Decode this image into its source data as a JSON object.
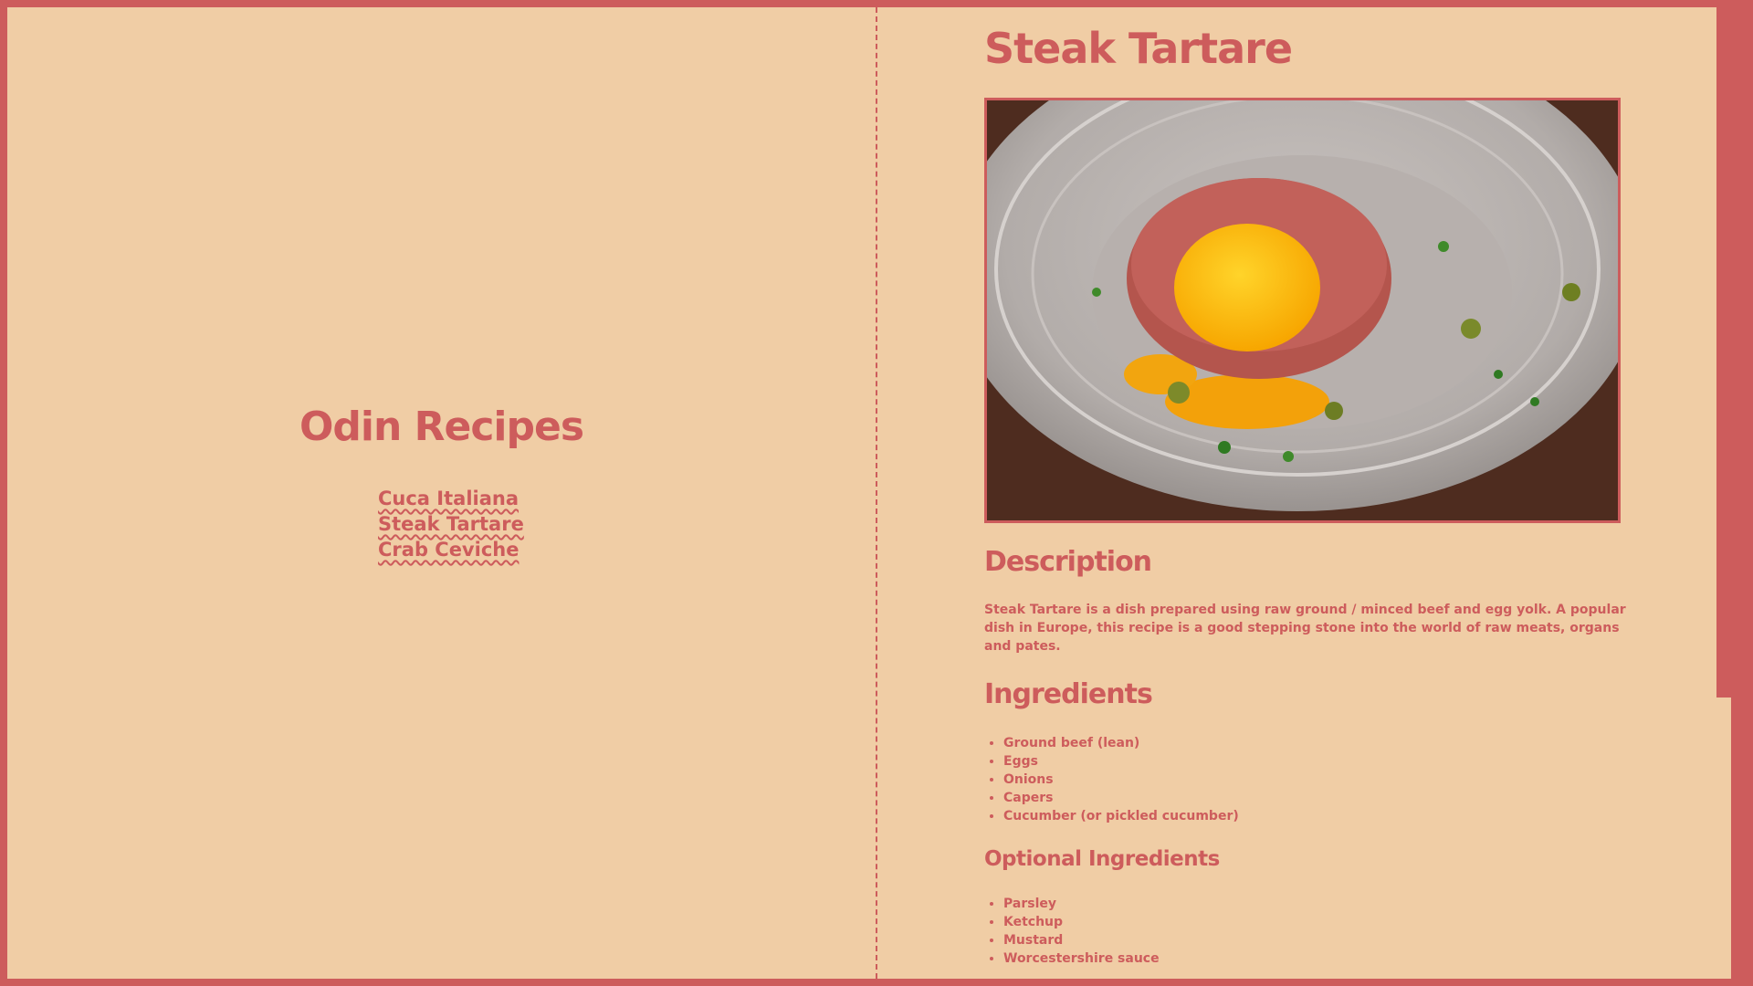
{
  "site": {
    "title": "Odin Recipes",
    "nav": [
      {
        "label": "Cuca Italiana"
      },
      {
        "label": "Steak Tartare"
      },
      {
        "label": "Crab Ceviche"
      }
    ]
  },
  "recipe": {
    "title": "Steak Tartare",
    "image_icon": "dish-photo",
    "description_heading": "Description",
    "description": "Steak Tartare is a dish prepared using raw ground / minced beef and egg yolk. A popular dish in Europe, this recipe is a good stepping stone into the world of raw meats, organs and pates.",
    "ingredients_heading": "Ingredients",
    "ingredients": [
      "Ground beef (lean)",
      "Eggs",
      "Onions",
      "Capers",
      "Cucumber (or pickled cucumber)"
    ],
    "optional_heading": "Optional Ingredients",
    "optional_ingredients": [
      "Parsley",
      "Ketchup",
      "Mustard",
      "Worcestershire sauce"
    ]
  },
  "colors": {
    "accent": "#cd5c5c",
    "background": "#f0cda5"
  }
}
